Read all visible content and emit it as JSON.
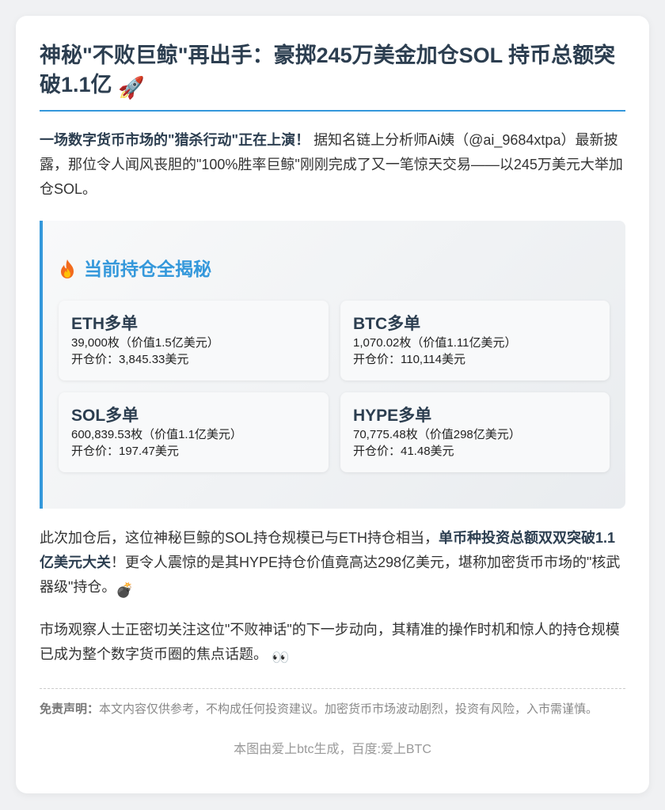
{
  "article": {
    "title": "神秘\"不败巨鲸\"再出手：豪掷245万美金加仓SOL 持币总额突破1.1亿",
    "title_emoji": "🚀",
    "lead_strong": "一场数字货币市场的\"猎杀行动\"正在上演！",
    "lead_text": "据知名链上分析师Ai姨（@ai_9684xtpa）最新披露，那位令人闻风丧胆的\"100%胜率巨鲸\"刚刚完成了又一笔惊天交易——以245万美元大举加仓SOL。"
  },
  "positions_panel": {
    "icon": "fire-icon",
    "title": "当前持仓全揭秘",
    "cards": [
      {
        "name": "ETH多单",
        "amount": "39,000枚（价值1.5亿美元）",
        "open_price": "开仓价：3,845.33美元"
      },
      {
        "name": "BTC多单",
        "amount": "1,070.02枚（价值1.11亿美元）",
        "open_price": "开仓价：110,114美元"
      },
      {
        "name": "SOL多单",
        "amount": "600,839.53枚（价值1.1亿美元）",
        "open_price": "开仓价：197.47美元"
      },
      {
        "name": "HYPE多单",
        "amount": "70,775.48枚（价值298亿美元）",
        "open_price": "开仓价：41.48美元"
      }
    ]
  },
  "body": {
    "para1_a": "此次加仓后，这位神秘巨鲸的SOL持仓规模已与ETH持仓相当，",
    "para1_strong": "单币种投资总额双双突破1.1亿美元大关",
    "para1_b": "！更令人震惊的是其HYPE持仓价值竟高达298亿美元，堪称加密货币市场的\"核武器级\"持仓。",
    "para1_emoji": "💣",
    "para2": "市场观察人士正密切关注这位\"不败神话\"的下一步动向，其精准的操作时机和惊人的持仓规模已成为整个数字货币圈的焦点话题。",
    "para2_emoji": "👀"
  },
  "disclaimer": {
    "label": "免责声明：",
    "text": "本文内容仅供参考，不构成任何投资建议。加密货币市场波动剧烈，投资有风险，入市需谨慎。"
  },
  "footer": {
    "text": "本图由爱上btc生成，百度:爱上BTC"
  },
  "colors": {
    "accent": "#3498db",
    "heading": "#2c3e50"
  }
}
